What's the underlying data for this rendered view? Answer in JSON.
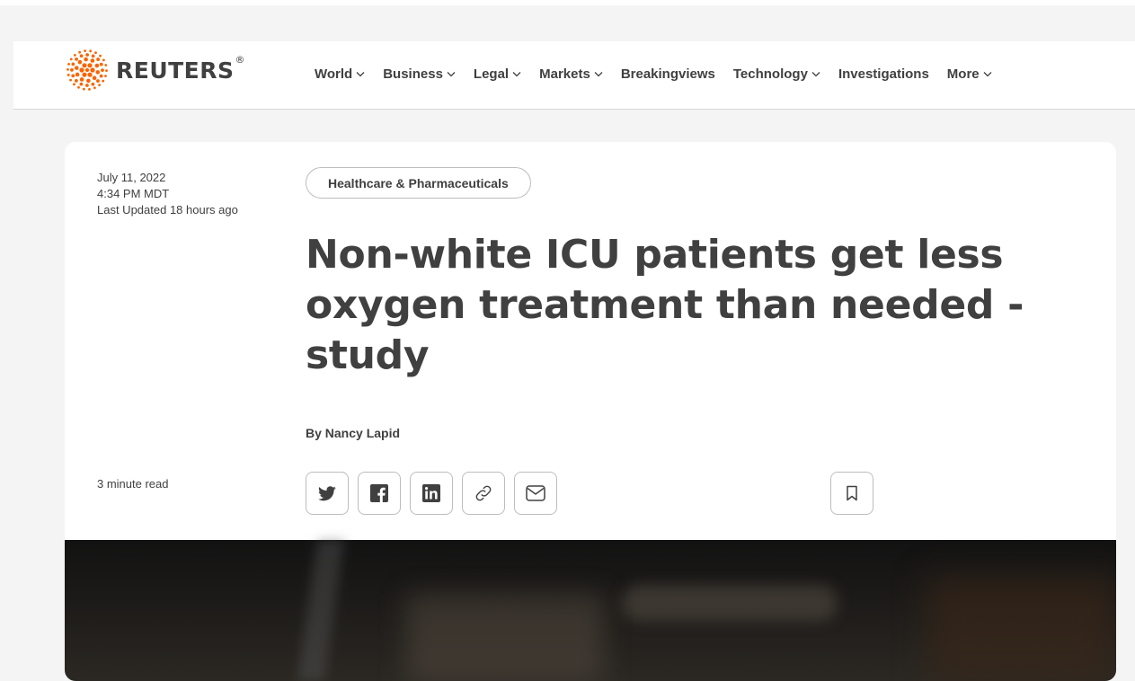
{
  "brand": {
    "name": "REUTERS",
    "trademark": "®"
  },
  "nav": [
    {
      "label": "World",
      "dropdown": true
    },
    {
      "label": "Business",
      "dropdown": true
    },
    {
      "label": "Legal",
      "dropdown": true
    },
    {
      "label": "Markets",
      "dropdown": true
    },
    {
      "label": "Breakingviews",
      "dropdown": false
    },
    {
      "label": "Technology",
      "dropdown": true
    },
    {
      "label": "Investigations",
      "dropdown": false
    },
    {
      "label": "More",
      "dropdown": true
    }
  ],
  "article": {
    "date": "July 11, 2022",
    "time": "4:34 PM MDT",
    "updated": "Last Updated 18 hours ago",
    "category": "Healthcare & Pharmaceuticals",
    "headline": "Non-white ICU patients get less oxygen treatment than needed - study",
    "byline": "By Nancy Lapid",
    "read_time": "3 minute read"
  },
  "share_icons": [
    "twitter-icon",
    "facebook-icon",
    "linkedin-icon",
    "link-icon",
    "email-icon"
  ],
  "colors": {
    "text": "#404040",
    "accent": "#fa6400",
    "border": "#bdbdbd"
  }
}
